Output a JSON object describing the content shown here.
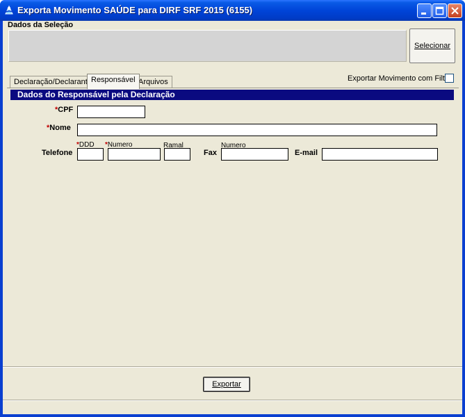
{
  "window": {
    "title": "Exporta Movimento SAÚDE para DIRF SRF 2015 (6155)",
    "icon": "app-icon",
    "controls": [
      "minimize-icon",
      "maximize-icon",
      "close-icon"
    ]
  },
  "selection": {
    "title": "Dados da Seleção",
    "button_label": "Selecionar"
  },
  "tabs": [
    {
      "label": "Declaração/Declarante",
      "active": false
    },
    {
      "label": "Responsável",
      "active": true
    },
    {
      "label": "Arquivos",
      "active": false
    }
  ],
  "filter": {
    "label": "Exportar Movimento com Filtro",
    "checked": false
  },
  "responsavel": {
    "header": "Dados do Responsável pela Declaração",
    "required_mark": "*",
    "cpf_label": "CPF",
    "cpf_value": "",
    "nome_label": "Nome",
    "nome_value": "",
    "telefone_label": "Telefone",
    "ddd_label": "DDD",
    "numero_label": "Numero",
    "ramal_label": "Ramal",
    "fax_label": "Fax",
    "fax_numero_label": "Numero",
    "email_label": "E-mail",
    "ddd_value": "",
    "numero_value": "",
    "ramal_value": "",
    "fax_value": "",
    "email_value": ""
  },
  "footer": {
    "export_label": "Exportar"
  },
  "colors": {
    "titlebar": "#0044d8",
    "section_header": "#0a0a80",
    "required": "#c00000",
    "client_bg": "#ece9d8"
  }
}
